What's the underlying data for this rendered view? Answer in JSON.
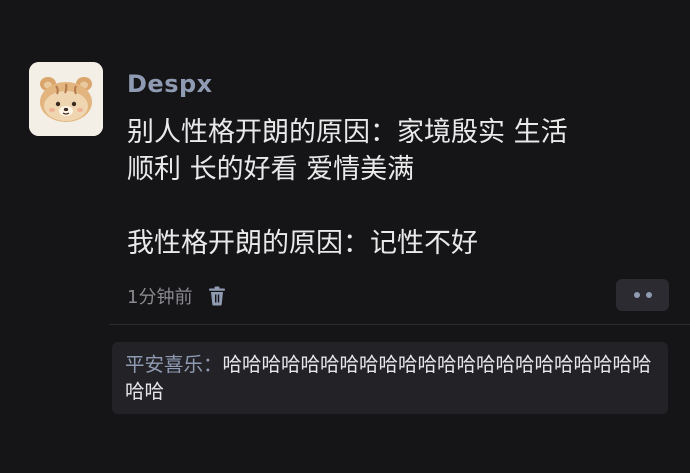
{
  "post": {
    "author": "Despx",
    "content_lines": [
      "别人性格开朗的原因：家境殷实 生活",
      "顺利 长的好看 爱情美满",
      "我性格开朗的原因：记性不好"
    ],
    "timestamp": "1分钟前",
    "icons": {
      "avatar": "bear-avatar-icon",
      "delete": "trash-icon",
      "more": "more-dots-icon"
    }
  },
  "reply": {
    "name": "平安喜乐：",
    "text": "哈哈哈哈哈哈哈哈哈哈哈哈哈哈哈哈哈哈哈哈哈哈哈哈"
  },
  "colors": {
    "background": "#151416",
    "author": "#8f9bb3",
    "text": "#e9e9ea",
    "meta": "#8a8a8f",
    "reply_bg": "#232327"
  }
}
